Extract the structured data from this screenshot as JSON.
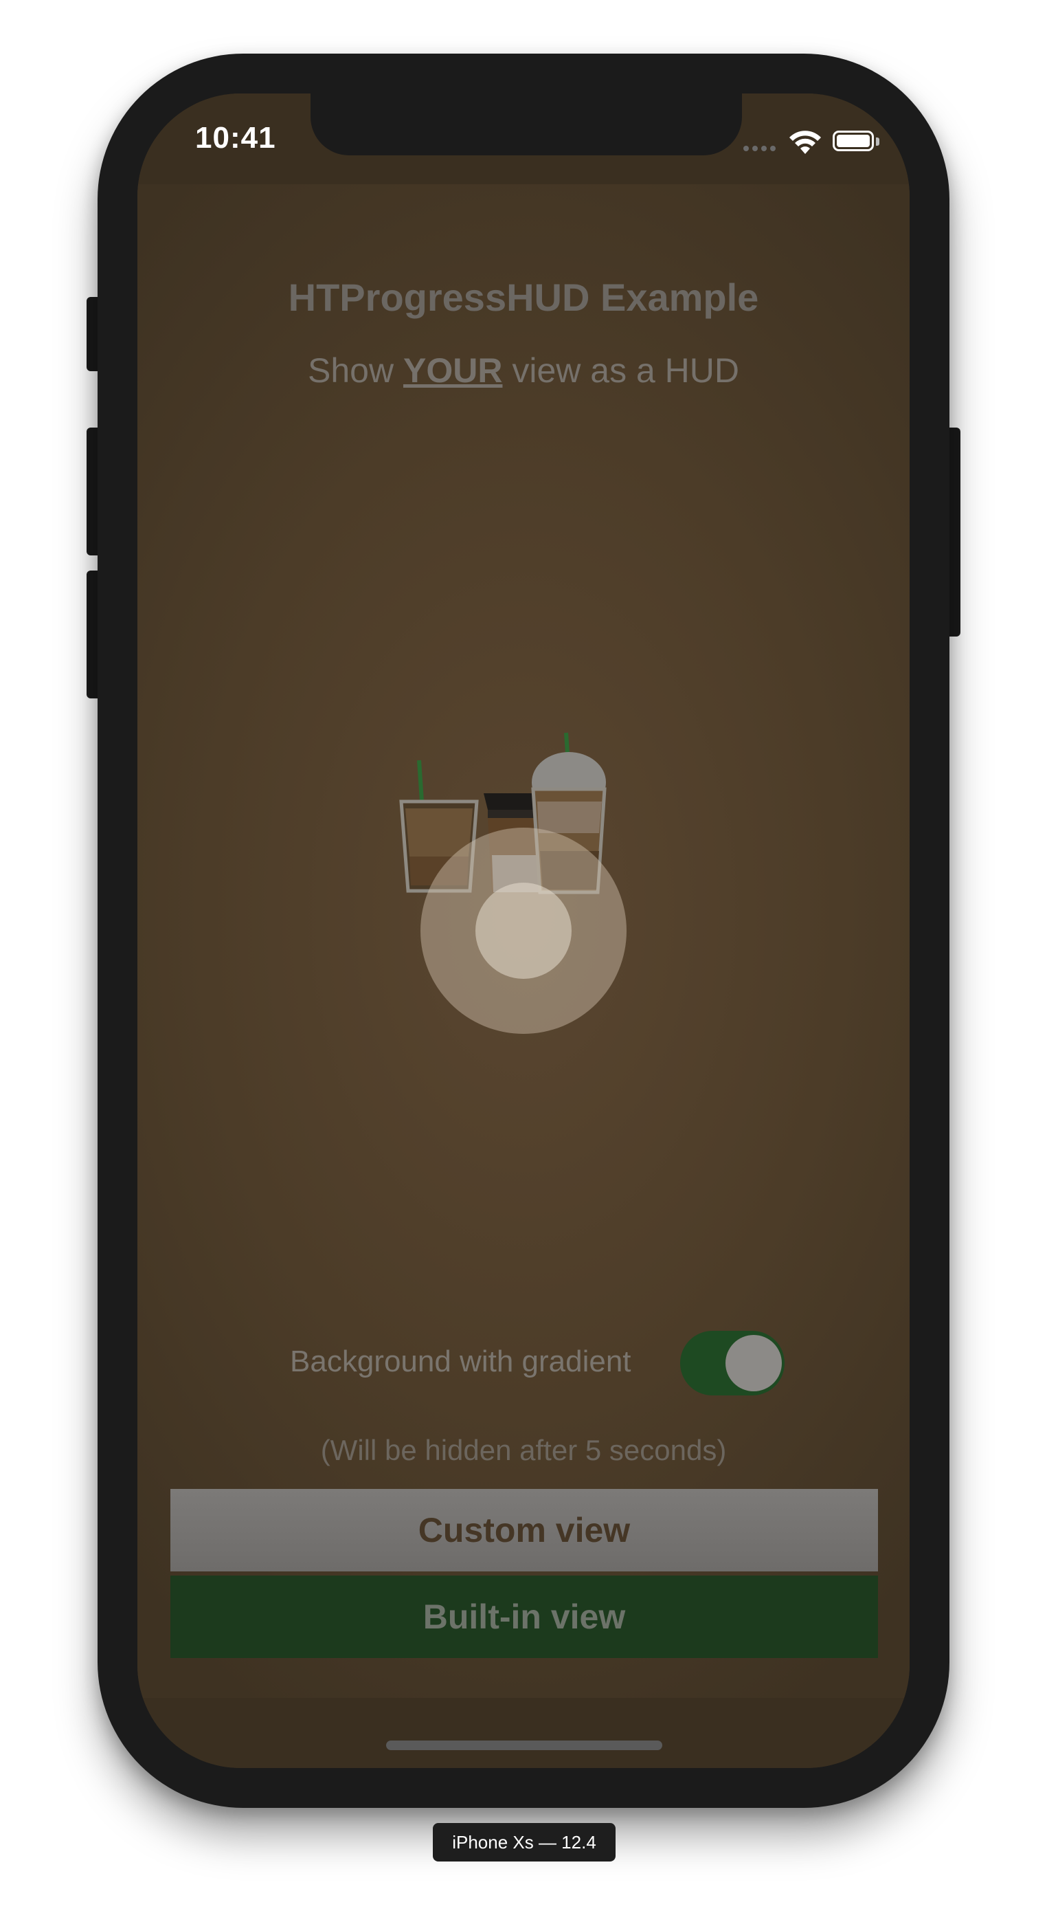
{
  "status_bar": {
    "time": "10:41",
    "icons": [
      "signal-dots-icon",
      "wifi-icon",
      "battery-icon"
    ]
  },
  "screen": {
    "title": "HTProgressHUD Example",
    "subtitle_prefix": "Show ",
    "subtitle_emphasis": "YOUR",
    "subtitle_suffix": " view as a HUD",
    "illustration": "coffee-cups-illustration",
    "spinner": "hud-spinner-icon"
  },
  "options": {
    "gradient_label": "Background with gradient",
    "gradient_enabled": true,
    "hidden_note": "(Will be hidden after 5 seconds)"
  },
  "buttons": {
    "custom_view": "Custom view",
    "builtin_view": "Built-in view"
  },
  "device_caption": "iPhone Xs — 12.4",
  "colors": {
    "background_gradient_center": "#5a4630",
    "background_gradient_edge": "#3e3222",
    "toggle_on": "#1e4a22",
    "builtin_button": "#1c3a1d",
    "custom_button": "#767472"
  }
}
